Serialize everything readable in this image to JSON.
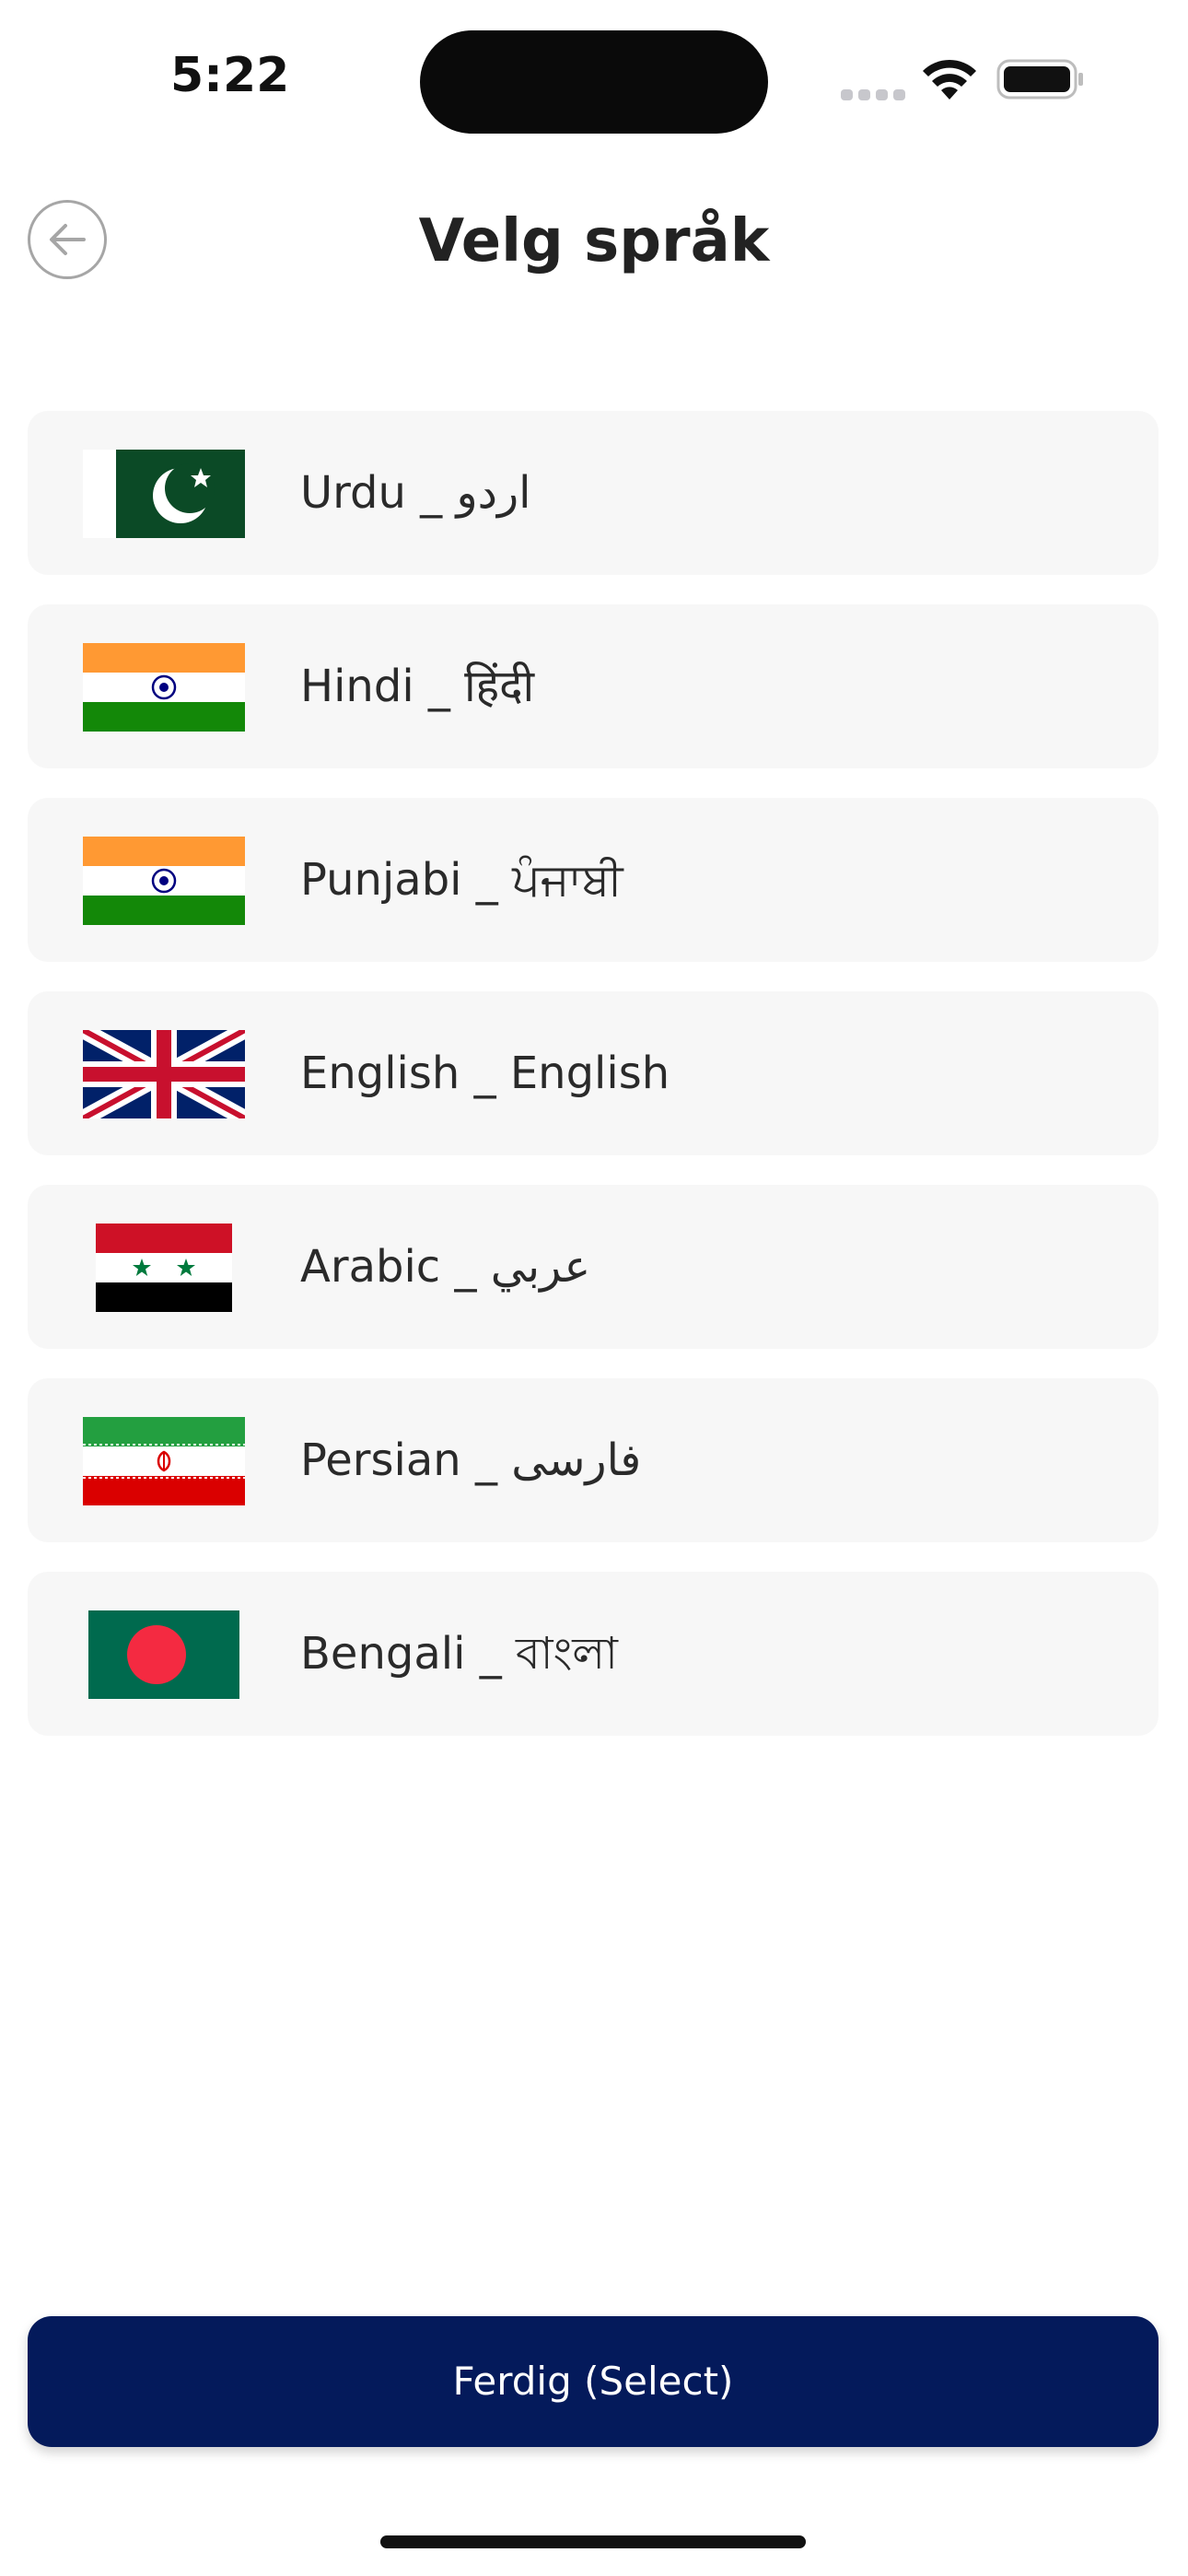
{
  "status_bar": {
    "time": "5:22",
    "icons": [
      "cellular-signal-icon",
      "wifi-icon",
      "battery-icon"
    ]
  },
  "header": {
    "title": "Velg språk",
    "back_icon": "arrow-left-icon"
  },
  "languages": [
    {
      "label": "Urdu _ اردو",
      "flag": "pakistan-flag"
    },
    {
      "label": "Hindi _ हिंदी",
      "flag": "india-flag"
    },
    {
      "label": "Punjabi _ ਪੰਜਾਬੀ",
      "flag": "india-flag"
    },
    {
      "label": "English _ English",
      "flag": "uk-flag"
    },
    {
      "label": "Arabic _ عربي",
      "flag": "syria-flag"
    },
    {
      "label": "Persian _ فارسی",
      "flag": "iran-flag"
    },
    {
      "label": "Bengali _ বাংলা",
      "flag": "bangladesh-flag"
    }
  ],
  "footer": {
    "done_label": "Ferdig (Select)"
  },
  "colors": {
    "primary_button": "#041a5b",
    "item_background": "#f7f7f7",
    "text": "#222222"
  }
}
